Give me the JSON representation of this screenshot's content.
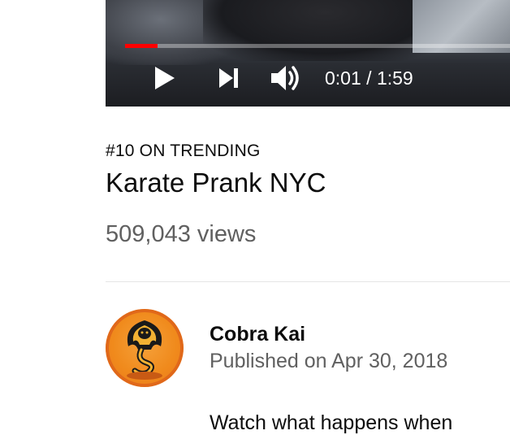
{
  "player": {
    "progress_fraction": 0.0084,
    "progress_color": "#ff0000",
    "current_time": "0:01",
    "separator": " / ",
    "duration": "1:59",
    "icons": [
      "play-icon",
      "next-icon",
      "volume-icon"
    ]
  },
  "video": {
    "trending": "#10 ON TRENDING",
    "title": "Karate Prank NYC",
    "views": "509,043 views"
  },
  "channel": {
    "name": "Cobra Kai",
    "published": "Published on Apr 30, 2018",
    "avatar_icon": "cobra-logo-icon",
    "avatar_color": "#f08a1c"
  },
  "description": {
    "peek_text": "Watch what happens when"
  }
}
